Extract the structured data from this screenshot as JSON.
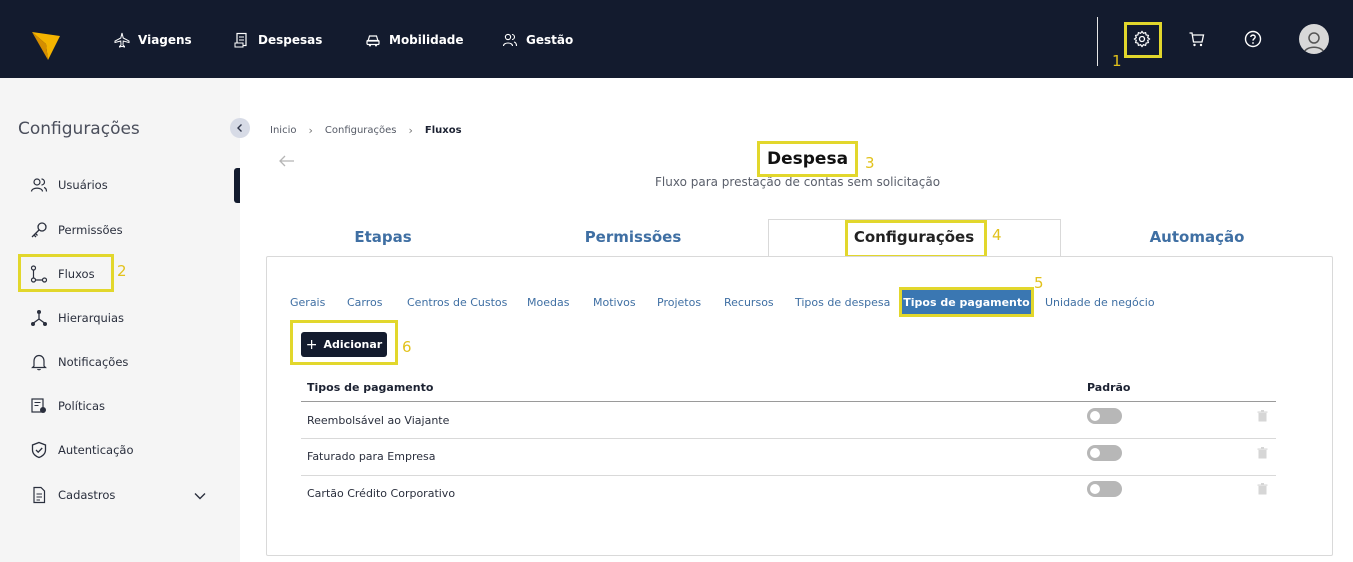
{
  "topnav": {
    "items": [
      {
        "label": "Viagens",
        "icon": "plane-icon"
      },
      {
        "label": "Despesas",
        "icon": "receipt-icon"
      },
      {
        "label": "Mobilidade",
        "icon": "car-icon"
      },
      {
        "label": "Gestão",
        "icon": "users-icon"
      }
    ],
    "right_icons": [
      "gear-icon",
      "cart-icon",
      "help-icon",
      "avatar"
    ]
  },
  "annotations": [
    "1",
    "2",
    "3",
    "4",
    "5",
    "6"
  ],
  "sidebar": {
    "title": "Configurações",
    "items": [
      {
        "label": "Usuários",
        "icon": "users-icon"
      },
      {
        "label": "Permissões",
        "icon": "key-icon"
      },
      {
        "label": "Fluxos",
        "icon": "flow-icon"
      },
      {
        "label": "Hierarquias",
        "icon": "hierarchy-icon"
      },
      {
        "label": "Notificações",
        "icon": "bell-icon"
      },
      {
        "label": "Políticas",
        "icon": "policy-icon"
      },
      {
        "label": "Autenticação",
        "icon": "shield-icon"
      },
      {
        "label": "Cadastros",
        "icon": "document-icon"
      }
    ]
  },
  "breadcrumb": [
    "Inicio",
    "Configurações",
    "Fluxos"
  ],
  "page": {
    "title": "Despesa",
    "subtitle": "Fluxo para prestação de contas sem solicitação"
  },
  "tabs": [
    "Etapas",
    "Permissões",
    "Configurações",
    "Automação"
  ],
  "subtabs": [
    "Gerais",
    "Carros",
    "Centros de Custos",
    "Moedas",
    "Motivos",
    "Projetos",
    "Recursos",
    "Tipos de despesa",
    "Tipos de pagamento",
    "Unidade de negócio"
  ],
  "add_button": "Adicionar",
  "table": {
    "headers": [
      "Tipos de pagamento",
      "Padrão"
    ],
    "rows": [
      {
        "name": "Reembolsável ao Viajante",
        "default": false
      },
      {
        "name": "Faturado para Empresa",
        "default": false
      },
      {
        "name": "Cartão Crédito Corporativo",
        "default": false
      }
    ]
  },
  "colors": {
    "topbar": "#131b2e",
    "accent": "#3a77b2",
    "highlight": "#e2d72c",
    "logo": "#f5b400"
  }
}
